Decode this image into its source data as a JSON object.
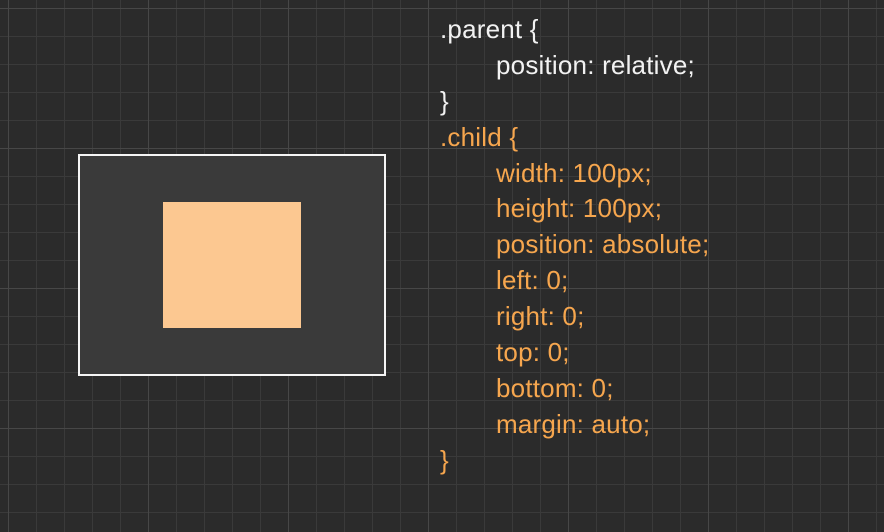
{
  "code": {
    "parent": {
      "selector": ".parent {",
      "rules": [
        "position: relative;"
      ],
      "close": "}"
    },
    "child": {
      "selector": ".child {",
      "rules": [
        "width: 100px;",
        "height: 100px;",
        "position: absolute;",
        "left: 0;",
        "right: 0;",
        "top: 0;",
        "bottom: 0;",
        "margin: auto;"
      ],
      "close": "}"
    }
  },
  "colors": {
    "parent_text": "#f2f2f2",
    "child_text": "#f6a64e",
    "child_box_bg": "#fcc891",
    "parent_box_bg": "#3a3a3a",
    "parent_box_border": "#f5f5f5",
    "page_bg": "#2b2b2b"
  }
}
